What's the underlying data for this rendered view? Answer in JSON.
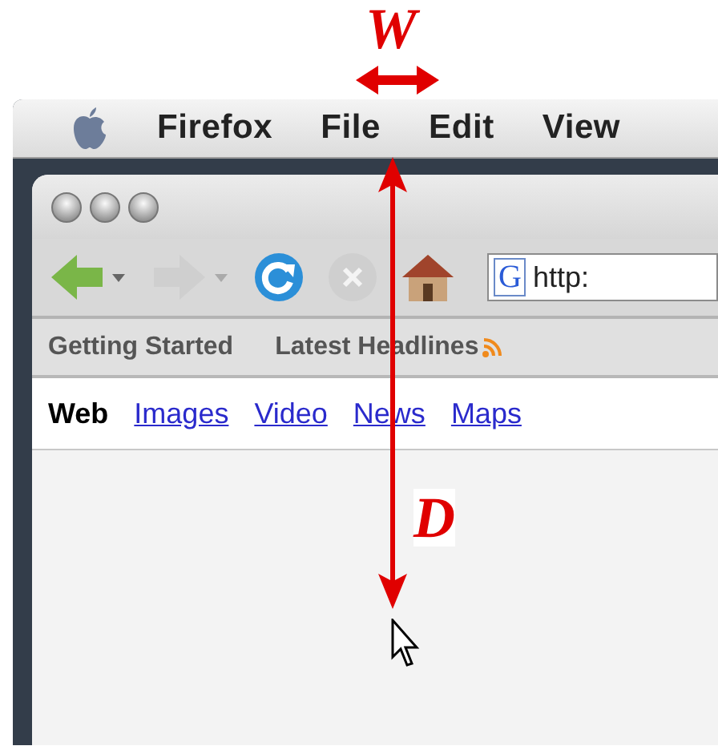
{
  "annotations": [
    {
      "kind": "width",
      "label": "W"
    },
    {
      "kind": "distance",
      "label": "D"
    }
  ],
  "menu_bar": {
    "items": [
      "Firefox",
      "File",
      "Edit",
      "View"
    ]
  },
  "toolbar": {
    "favicon": "G",
    "url": "http:"
  },
  "bookmarks": [
    {
      "label": "Getting Started",
      "feed": false
    },
    {
      "label": "Latest Headlines",
      "feed": true
    }
  ],
  "search_nav": [
    {
      "label": "Web",
      "selected": true
    },
    {
      "label": "Images",
      "selected": false
    },
    {
      "label": "Video",
      "selected": false
    },
    {
      "label": "News",
      "selected": false
    },
    {
      "label": "Maps",
      "selected": false
    }
  ]
}
